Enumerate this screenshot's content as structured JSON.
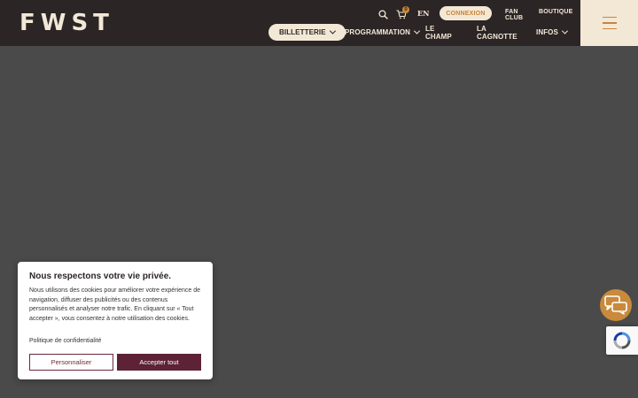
{
  "header": {
    "logo": "FWST",
    "cart_count": "0",
    "language": "EN",
    "connexion_label": "CONNEXION",
    "fan_club_label": "FAN CLUB",
    "boutique_label": "BOUTIQUE"
  },
  "nav": {
    "items": [
      {
        "label": "BILLETTERIE",
        "dropdown": true,
        "active": true
      },
      {
        "label": "PROGRAMMATION",
        "dropdown": true
      },
      {
        "label": "LE CHAMP",
        "dropdown": false
      },
      {
        "label": "LA CAGNOTTE",
        "dropdown": false
      },
      {
        "label": "INFOS",
        "dropdown": true
      }
    ]
  },
  "cookie": {
    "title": "Nous respectons votre vie privée.",
    "body": "Nous utilisons des cookies pour améliorer votre expérience de navigation, diffuser des publicités ou des contenus personnalisés et analyser notre trafic. En cliquant sur « Tout accepter », vous consentez à notre utilisation des cookies.",
    "policy_link": "Politique de confidentialité",
    "customize_label": "Personnaliser",
    "accept_label": "Accepter tout"
  },
  "colors": {
    "header_bg": "#2c2526",
    "cream": "#f3e8d6",
    "accent": "#c98a3c",
    "burgundy": "#5d2236",
    "page_bg": "#4a4a4a"
  },
  "icons": {
    "search": "search-icon",
    "cart": "cart-icon",
    "menu": "hamburger-icon",
    "chat": "chat-bubbles-icon",
    "recaptcha": "recaptcha-icon"
  }
}
